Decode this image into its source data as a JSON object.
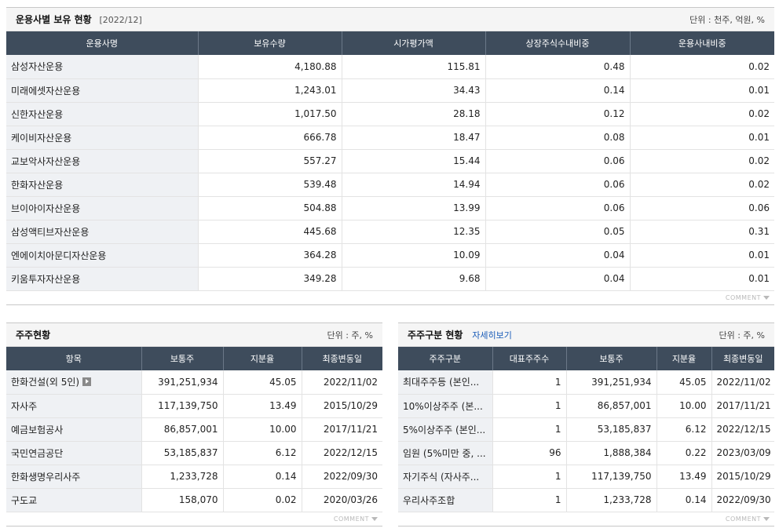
{
  "fund_holdings": {
    "title": "운용사별 보유 현황",
    "date": "[2022/12]",
    "unit": "단위 : 천주, 억원, %",
    "columns": [
      "운용사명",
      "보유수량",
      "시가평가액",
      "상장주식수내비중",
      "운용사내비중"
    ],
    "rows": [
      [
        "삼성자산운용",
        "4,180.88",
        "115.81",
        "0.48",
        "0.02"
      ],
      [
        "미래에셋자산운용",
        "1,243.01",
        "34.43",
        "0.14",
        "0.01"
      ],
      [
        "신한자산운용",
        "1,017.50",
        "28.18",
        "0.12",
        "0.02"
      ],
      [
        "케이비자산운용",
        "666.78",
        "18.47",
        "0.08",
        "0.01"
      ],
      [
        "교보악사자산운용",
        "557.27",
        "15.44",
        "0.06",
        "0.02"
      ],
      [
        "한화자산운용",
        "539.48",
        "14.94",
        "0.06",
        "0.02"
      ],
      [
        "브이아이자산운용",
        "504.88",
        "13.99",
        "0.06",
        "0.06"
      ],
      [
        "삼성액티브자산운용",
        "445.68",
        "12.35",
        "0.05",
        "0.31"
      ],
      [
        "엔에이치아문디자산운용",
        "364.28",
        "10.09",
        "0.04",
        "0.01"
      ],
      [
        "키움투자자산운용",
        "349.28",
        "9.68",
        "0.04",
        "0.01"
      ]
    ],
    "comment_label": "COMMENT"
  },
  "shareholders": {
    "title": "주주현황",
    "unit": "단위 : 주, %",
    "columns": [
      "항목",
      "보통주",
      "지분율",
      "최종변동일"
    ],
    "rows": [
      [
        "한화건설(외 5인)",
        "391,251,934",
        "45.05",
        "2022/11/02"
      ],
      [
        "자사주",
        "117,139,750",
        "13.49",
        "2015/10/29"
      ],
      [
        "예금보험공사",
        "86,857,001",
        "10.00",
        "2017/11/21"
      ],
      [
        "국민연금공단",
        "53,185,837",
        "6.12",
        "2022/12/15"
      ],
      [
        "한화생명우리사주",
        "1,233,728",
        "0.14",
        "2022/09/30"
      ],
      [
        "구도교",
        "158,070",
        "0.02",
        "2020/03/26"
      ]
    ],
    "comment_label": "COMMENT"
  },
  "shareholder_types": {
    "title": "주주구분 현황",
    "detail_link": "자세히보기",
    "unit": "단위 : 주, %",
    "columns": [
      "주주구분",
      "대표주주수",
      "보통주",
      "지분율",
      "최종변동일"
    ],
    "rows": [
      [
        "최대주주등 (본인...",
        "1",
        "391,251,934",
        "45.05",
        "2022/11/02"
      ],
      [
        "10%이상주주 (본...",
        "1",
        "86,857,001",
        "10.00",
        "2017/11/21"
      ],
      [
        "5%이상주주 (본인...",
        "1",
        "53,185,837",
        "6.12",
        "2022/12/15"
      ],
      [
        "임원 (5%미만 중, ...",
        "96",
        "1,888,384",
        "0.22",
        "2023/03/09"
      ],
      [
        "자기주식 (자사주...",
        "1",
        "117,139,750",
        "13.49",
        "2015/10/29"
      ],
      [
        "우리사주조합",
        "1",
        "1,233,728",
        "0.14",
        "2022/09/30"
      ]
    ],
    "comment_label": "COMMENT"
  }
}
